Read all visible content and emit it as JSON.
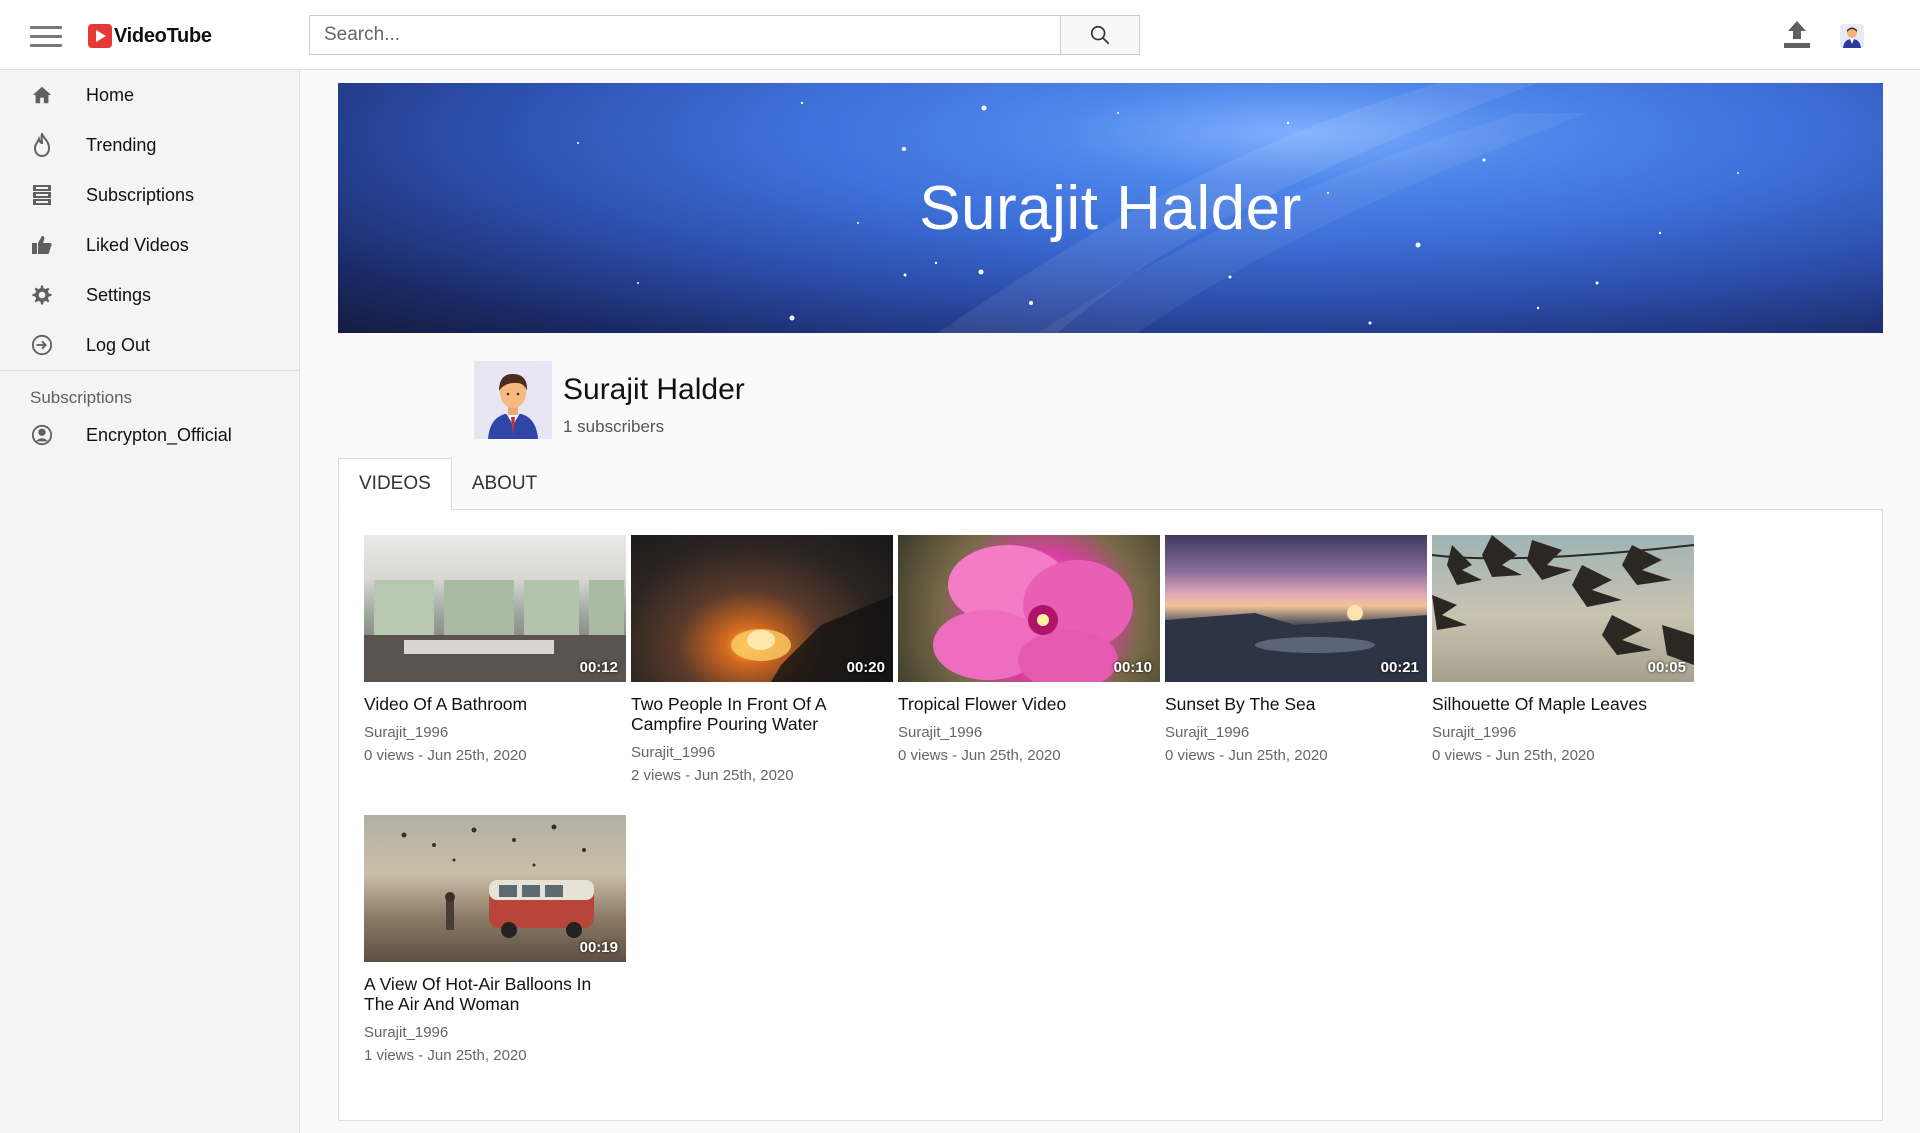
{
  "header": {
    "logo_text": "VideoTube",
    "search_placeholder": "Search..."
  },
  "sidebar": {
    "items": [
      {
        "label": "Home",
        "icon": "home-icon"
      },
      {
        "label": "Trending",
        "icon": "flame-icon"
      },
      {
        "label": "Subscriptions",
        "icon": "subscriptions-icon"
      },
      {
        "label": "Liked Videos",
        "icon": "thumbs-up-icon"
      },
      {
        "label": "Settings",
        "icon": "gear-icon"
      },
      {
        "label": "Log Out",
        "icon": "logout-icon"
      }
    ],
    "subscriptions_heading": "Subscriptions",
    "subscriptions": [
      {
        "label": "Encrypton_Official",
        "icon": "user-circle-icon"
      }
    ]
  },
  "channel": {
    "banner_title": "Surajit Halder",
    "name": "Surajit Halder",
    "subscribers": "1 subscribers"
  },
  "tabs": [
    {
      "label": "VIDEOS",
      "active": true
    },
    {
      "label": "ABOUT",
      "active": false
    }
  ],
  "videos": [
    {
      "title": "Video Of A Bathroom",
      "author": "Surajit_1996",
      "meta": "0 views - Jun 25th, 2020",
      "duration": "00:12"
    },
    {
      "title": "Two People In Front Of A Campfire Pouring Water",
      "author": "Surajit_1996",
      "meta": "2 views - Jun 25th, 2020",
      "duration": "00:20"
    },
    {
      "title": "Tropical Flower Video",
      "author": "Surajit_1996",
      "meta": "0 views - Jun 25th, 2020",
      "duration": "00:10"
    },
    {
      "title": "Sunset By The Sea",
      "author": "Surajit_1996",
      "meta": "0 views - Jun 25th, 2020",
      "duration": "00:21"
    },
    {
      "title": "Silhouette Of Maple Leaves",
      "author": "Surajit_1996",
      "meta": "0 views - Jun 25th, 2020",
      "duration": "00:05"
    },
    {
      "title": "A View Of Hot-Air Balloons In The Air And Woman",
      "author": "Surajit_1996",
      "meta": "1 views - Jun 25th, 2020",
      "duration": "00:19"
    }
  ],
  "colors": {
    "logo_red": "#e53935",
    "banner_blue": "#3d6fd8",
    "sidebar_bg": "#f4f4f4"
  }
}
